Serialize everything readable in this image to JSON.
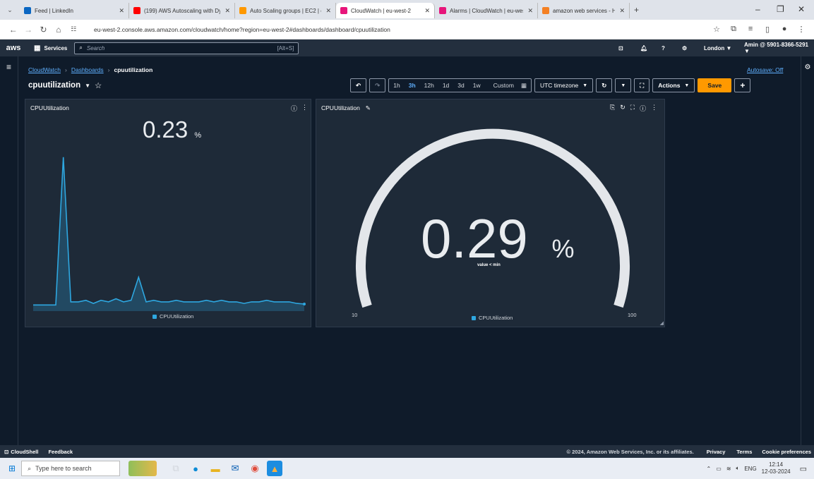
{
  "browser": {
    "tabs": [
      {
        "title": "Feed | LinkedIn",
        "color": "#0a66c2",
        "active": false
      },
      {
        "title": "(199) AWS Autoscaling with Dy",
        "color": "#ff0000",
        "active": false
      },
      {
        "title": "Auto Scaling groups | EC2 | eu",
        "color": "#ff9900",
        "active": false
      },
      {
        "title": "CloudWatch | eu-west-2",
        "color": "#e7157b",
        "active": true
      },
      {
        "title": "Alarms | CloudWatch | eu-west",
        "color": "#e7157b",
        "active": false
      },
      {
        "title": "amazon web services - How to",
        "color": "#f48024",
        "active": false
      }
    ],
    "url": "eu-west-2.console.aws.amazon.com/cloudwatch/home?region=eu-west-2#dashboards/dashboard/cpuutilization"
  },
  "awsnav": {
    "logo": "aws",
    "services": "Services",
    "search_placeholder": "Search",
    "search_hotkey": "[Alt+S]",
    "region": "London ▼",
    "account": "Amin @ 5901-8366-5291 ▼"
  },
  "breadcrumb": {
    "root": "CloudWatch",
    "mid": "Dashboards",
    "current": "cpuutilization"
  },
  "dashboard": {
    "title": "cpuutilization",
    "autosave": "Autosave: Off",
    "time_ranges": [
      "1h",
      "3h",
      "12h",
      "1d",
      "3d",
      "1w"
    ],
    "selected_range": "3h",
    "custom": "Custom",
    "timezone": "UTC timezone",
    "actions": "Actions",
    "save": "Save"
  },
  "widget_line": {
    "title": "CPUUtilization",
    "value": "0.23",
    "unit": "%",
    "legend": "CPUUtilization"
  },
  "widget_gauge": {
    "title": "CPUUtilization",
    "value": "0.29",
    "unit": "%",
    "note": "value < min",
    "min": "10",
    "max": "100",
    "legend": "CPUUtilization"
  },
  "chart_data": {
    "type": "area",
    "series": [
      {
        "name": "CPUUtilization",
        "values": [
          0.2,
          0.2,
          0.2,
          0.2,
          5.0,
          0.3,
          0.3,
          0.35,
          0.25,
          0.35,
          0.3,
          0.4,
          0.3,
          0.35,
          1.1,
          0.3,
          0.35,
          0.3,
          0.3,
          0.35,
          0.3,
          0.3,
          0.3,
          0.35,
          0.3,
          0.35,
          0.3,
          0.3,
          0.25,
          0.3,
          0.3,
          0.35,
          0.3,
          0.3,
          0.3,
          0.25,
          0.23
        ]
      }
    ],
    "color": "#2ea7e0",
    "ylim": [
      0,
      5.5
    ],
    "grid": false,
    "legend": "bottom"
  },
  "footer": {
    "cloudshell": "CloudShell",
    "feedback": "Feedback",
    "copyright": "© 2024, Amazon Web Services, Inc. or its affiliates.",
    "privacy": "Privacy",
    "terms": "Terms",
    "cookies": "Cookie preferences"
  },
  "taskbar": {
    "search_placeholder": "Type here to search",
    "lang": "ENG",
    "time": "12:14",
    "date": "12-03-2024"
  }
}
